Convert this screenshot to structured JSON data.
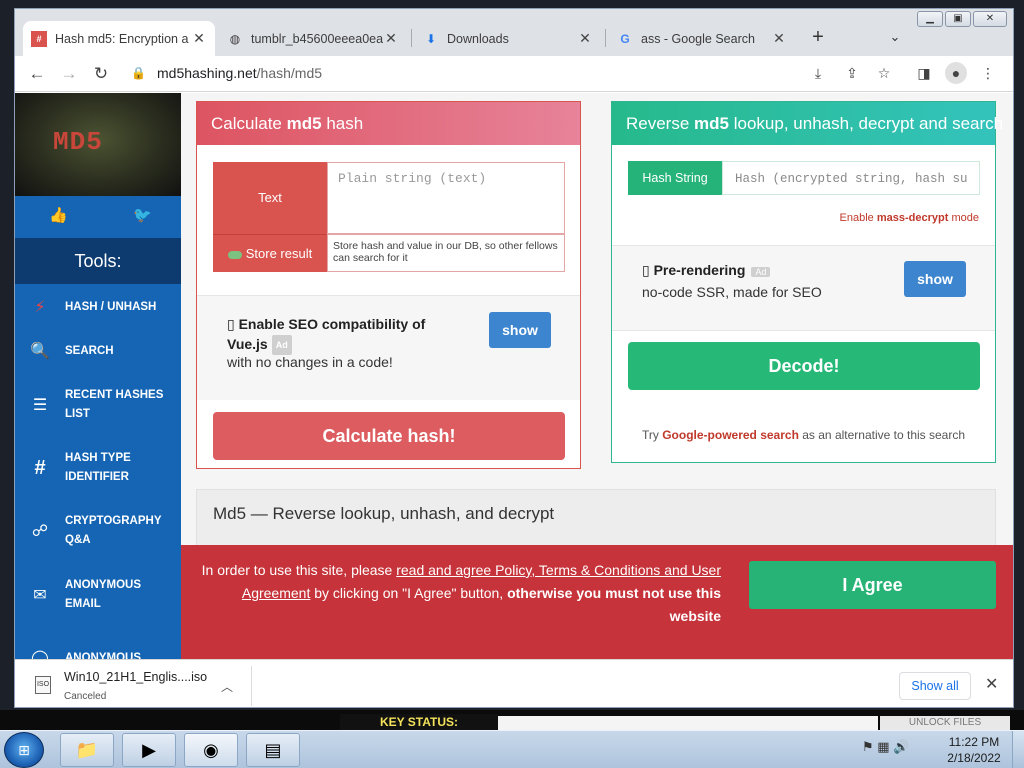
{
  "browser": {
    "tabs": [
      {
        "title": "Hash md5: Encryption a",
        "icon": "md5-favicon",
        "active": true
      },
      {
        "title": "tumblr_b45600eeea0ea",
        "icon": "globe-icon",
        "active": false
      },
      {
        "title": "Downloads",
        "icon": "download-icon",
        "active": false
      },
      {
        "title": "ass - Google Search",
        "icon": "google-icon",
        "active": false
      }
    ],
    "url_host": "md5hashing.net",
    "url_path": "/hash/md5"
  },
  "sidebar": {
    "logo_text": "MD5",
    "tools_heading": "Tools:",
    "items": [
      {
        "label": "HASH / UNHASH",
        "icon": "bolt-icon",
        "icon_glyph": "⚡"
      },
      {
        "label": "SEARCH",
        "icon": "search-icon",
        "icon_glyph": "🔍"
      },
      {
        "label": "RECENT HASHES LIST",
        "icon": "list-icon",
        "icon_glyph": "☰"
      },
      {
        "label": "HASH TYPE IDENTIFIER",
        "icon": "hash-icon",
        "icon_glyph": "#"
      },
      {
        "label": "CRYPTOGRAPHY Q&A",
        "icon": "chat-icon",
        "icon_glyph": "☍"
      },
      {
        "label": "ANONYMOUS EMAIL",
        "icon": "envelope-icon",
        "icon_glyph": "✉"
      },
      {
        "label": "ANONYMOUS",
        "icon": "chat-bubble-icon",
        "icon_glyph": "◯"
      }
    ]
  },
  "calc": {
    "title_pre": "Calculate",
    "title_bold": "md5",
    "title_post": "hash",
    "text_label": "Text",
    "text_placeholder": "Plain string (text)",
    "store_label": "Store result",
    "store_desc": "Store hash and value in our DB, so other fellows can search for it",
    "seo_title": "Enable SEO compatibility of Vue.js",
    "seo_ad": "Ad",
    "seo_desc": "with no changes in a code!",
    "seo_show": "show",
    "button": "Calculate hash!"
  },
  "reverse": {
    "title_pre": "Reverse",
    "title_bold": "md5",
    "title_post": "lookup, unhash, decrypt and search",
    "hash_label": "Hash String",
    "hash_placeholder": "Hash (encrypted string, hash su",
    "mass_pre": "Enable",
    "mass_bold": "mass-decrypt",
    "mass_post": "mode",
    "pre_title": "Pre-rendering",
    "pre_ad": "Ad",
    "pre_desc": "no-code SSR, made for SEO",
    "pre_show": "show",
    "button": "Decode!",
    "alt_pre": "Try",
    "alt_link": "Google-powered search",
    "alt_post": "as an alternative to this search"
  },
  "md5_section": {
    "title": "Md5 — Reverse lookup, unhash, and decrypt"
  },
  "consent": {
    "text_pre": "In order to use this site, please",
    "link": "read and agree Policy, Terms & Conditions and User Agreement",
    "text_mid": "by clicking on \"I Agree\" button,",
    "text_bold": "otherwise you must not use this website",
    "button": "I Agree"
  },
  "download": {
    "filename": "Win10_21H1_Englis....iso",
    "status": "Canceled",
    "file_badge": "ISO",
    "show_all": "Show all"
  },
  "desktop": {
    "key_status": "KEY STATUS:",
    "unlock": "UNLOCK FILES"
  },
  "taskbar": {
    "time": "11:22 PM",
    "date": "2/18/2022"
  },
  "colors": {
    "calc_accent": "#d9534f",
    "reverse_accent": "#26b37a",
    "sidebar": "#1565b4",
    "consent": "#c6333a"
  }
}
